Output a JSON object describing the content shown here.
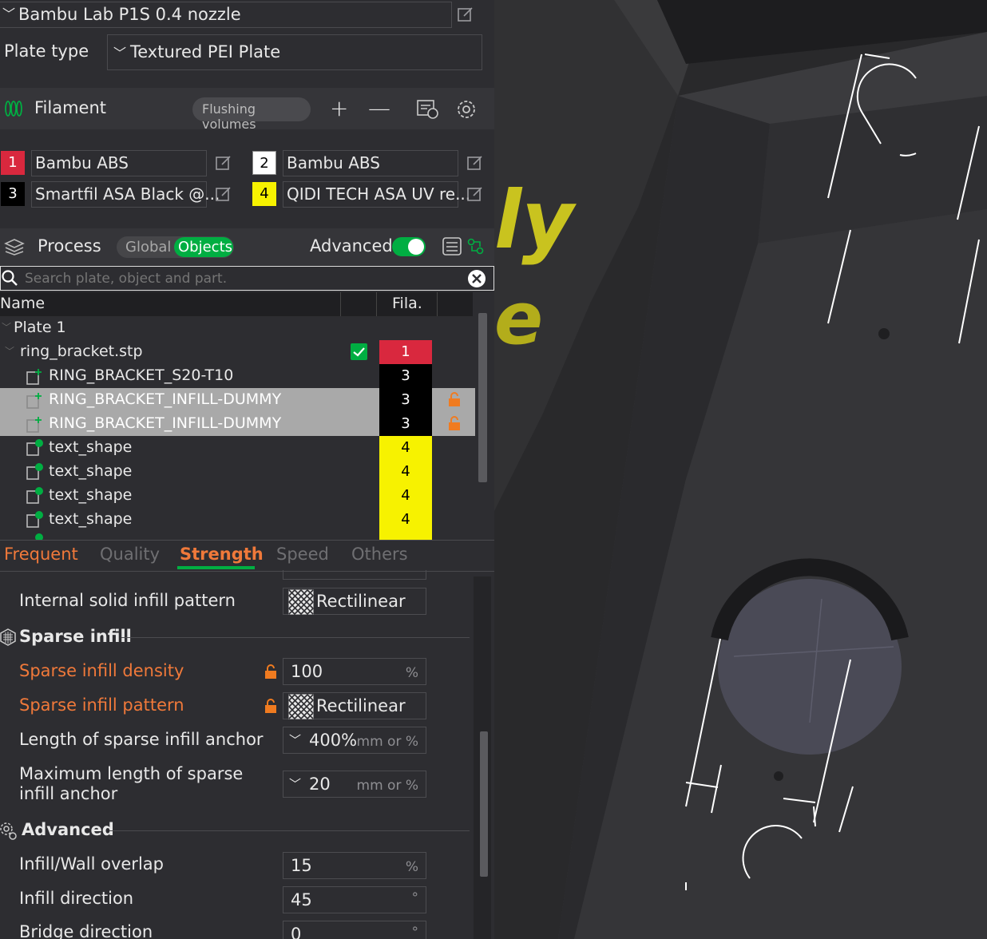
{
  "printer": {
    "name": "Bambu Lab P1S 0.4 nozzle"
  },
  "plate_type": {
    "label": "Plate type",
    "value": "Textured PEI Plate"
  },
  "filament": {
    "title": "Filament",
    "flushing_button": "Flushing volumes",
    "slots": [
      {
        "num": "1",
        "name": "Bambu ABS",
        "color": "#d9283e",
        "num_color": "#ffffff"
      },
      {
        "num": "2",
        "name": "Bambu ABS",
        "color": "#ffffff",
        "num_color": "#000000"
      },
      {
        "num": "3",
        "name": "Smartfil ASA Black @...",
        "color": "#000000",
        "num_color": "#ffffff"
      },
      {
        "num": "4",
        "name": "QIDI TECH ASA UV re...",
        "color": "#f7f200",
        "num_color": "#000000"
      }
    ]
  },
  "process": {
    "title": "Process",
    "toggle_global": "Global",
    "toggle_objects": "Objects",
    "advanced_label": "Advanced",
    "advanced_on": true
  },
  "search": {
    "placeholder": "Search plate, object and part."
  },
  "object_list": {
    "col_name": "Name",
    "col_fila": "Fila.",
    "rows": [
      {
        "name": "Plate 1",
        "fila": "",
        "selected": false
      },
      {
        "name": "ring_bracket.stp",
        "fila": "1",
        "selected": false
      },
      {
        "name": "RING_BRACKET_S20-T10",
        "fila": "3",
        "selected": false
      },
      {
        "name": "RING_BRACKET_INFILL-DUMMY",
        "fila": "3",
        "selected": true
      },
      {
        "name": "RING_BRACKET_INFILL-DUMMY",
        "fila": "3",
        "selected": true
      },
      {
        "name": "text_shape",
        "fila": "4",
        "selected": false
      },
      {
        "name": "text_shape",
        "fila": "4",
        "selected": false
      },
      {
        "name": "text_shape",
        "fila": "4",
        "selected": false
      },
      {
        "name": "text_shape",
        "fila": "4",
        "selected": false
      }
    ]
  },
  "tabs": [
    {
      "label": "Frequent",
      "state": "orange"
    },
    {
      "label": "Quality",
      "state": "inactive"
    },
    {
      "label": "Strength",
      "state": "active"
    },
    {
      "label": "Speed",
      "state": "inactive"
    },
    {
      "label": "Others",
      "state": "inactive"
    }
  ],
  "settings": {
    "internal_solid_infill_pattern": {
      "label": "Internal solid infill pattern",
      "value": "Rectilinear"
    },
    "sparse_infill_heading": "Sparse infill",
    "sparse_infill_density": {
      "label": "Sparse infill density",
      "value": "100",
      "unit": "%"
    },
    "sparse_infill_pattern": {
      "label": "Sparse infill pattern",
      "value": "Rectilinear"
    },
    "anchor_length": {
      "label": "Length of sparse infill anchor",
      "value": "400%",
      "unit": "mm or %"
    },
    "anchor_max_line1": "Maximum length of sparse",
    "anchor_max_line2": "infill anchor",
    "anchor_max": {
      "value": "20",
      "unit": "mm or %"
    },
    "advanced_heading": "Advanced",
    "infill_wall_overlap": {
      "label": "Infill/Wall overlap",
      "value": "15",
      "unit": "%"
    },
    "infill_direction": {
      "label": "Infill direction",
      "value": "45",
      "unit": "°"
    },
    "bridge_direction": {
      "label": "Bridge direction",
      "value": "0",
      "unit": "°"
    }
  },
  "colors": {
    "accent": "#00ae42",
    "orange": "#f0793a",
    "selected_row": "#a9a9a9"
  }
}
